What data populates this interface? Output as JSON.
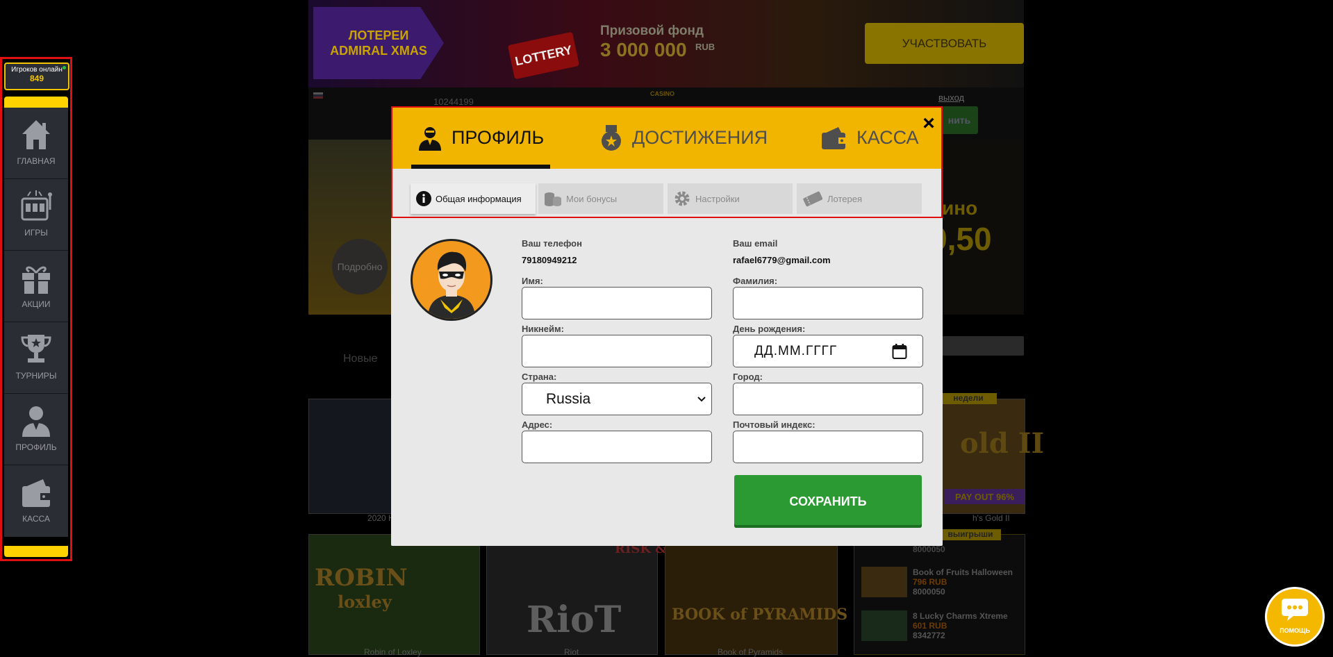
{
  "banner": {
    "lottery_line1": "ЛОТЕРЕИ",
    "lottery_line2": "ADMIRAL XMAS",
    "tag": "LOTTERY",
    "prize_title": "Призовой фонд",
    "prize_amount": "3 000 000",
    "prize_currency": "RUB",
    "participate": "УЧАСТВОВАТЬ"
  },
  "header": {
    "user_id": "10244199",
    "logout": "выход",
    "logo_small": "CASINO",
    "deposit_partial": "нить"
  },
  "hero": {
    "more": "Подробно",
    "text1": "ино",
    "text2": "9,50"
  },
  "categories": {
    "new": "Новые"
  },
  "games": {
    "caption1": "2020 H",
    "caption_right": "h's Gold II",
    "week_label": "недели",
    "payout": "PAY OUT 96%",
    "wins_label": "выигрыши",
    "tile1": "ROBIN",
    "tile1_sub": "loxley",
    "tile2": "RioT",
    "tile3": "BOOK of PYRAMIDS",
    "tile1_caption": "Robin of Loxley",
    "tile2_caption": "Riot",
    "tile3_caption": "Book of Pyramids",
    "risk_buy": "RISK &Buy",
    "gold_text": "old II",
    "win_partial_id": "8000050"
  },
  "recent_wins": [
    {
      "name": "Book of Fruits Halloween",
      "amount": "796 RUB",
      "id": "8000050"
    },
    {
      "name": "8 Lucky Charms Xtreme",
      "amount": "601 RUB",
      "id": "8342772"
    }
  ],
  "sidebar": {
    "online_label": "Игроков онлайн",
    "online_count": "849",
    "items": [
      {
        "label": "ГЛАВНАЯ",
        "icon": "home-icon"
      },
      {
        "label": "ИГРЫ",
        "icon": "slot-machine-icon"
      },
      {
        "label": "АКЦИИ",
        "icon": "gift-icon"
      },
      {
        "label": "ТУРНИРЫ",
        "icon": "trophy-icon"
      },
      {
        "label": "ПРОФИЛЬ",
        "icon": "user-icon"
      },
      {
        "label": "КАССА",
        "icon": "wallet-icon"
      }
    ]
  },
  "modal": {
    "tabs": [
      {
        "label": "ПРОФИЛЬ",
        "icon": "user-icon",
        "active": true
      },
      {
        "label": "ДОСТИЖЕНИЯ",
        "icon": "medal-icon",
        "active": false
      },
      {
        "label": "КАССА",
        "icon": "wallet-icon",
        "active": false
      }
    ],
    "close": "×",
    "subtabs": [
      {
        "label": "Общая информация",
        "icon": "info-icon",
        "active": true
      },
      {
        "label": "Мои бонусы",
        "icon": "coins-icon",
        "active": false
      },
      {
        "label": "Настройки",
        "icon": "gear-icon",
        "active": false
      },
      {
        "label": "Лотерея",
        "icon": "ticket-icon",
        "active": false
      }
    ],
    "phone_label": "Ваш телефон",
    "phone_value": "79180949212",
    "email_label": "Ваш email",
    "email_value": "rafael6779@gmail.com",
    "fields": {
      "first_name": {
        "label": "Имя:",
        "value": ""
      },
      "last_name": {
        "label": "Фамилия:",
        "value": ""
      },
      "nickname": {
        "label": "Никнейм:",
        "value": ""
      },
      "birthday": {
        "label": "День рождения:",
        "placeholder": "ДД.ММ.ГГГГ"
      },
      "country": {
        "label": "Страна:",
        "value": "Russia"
      },
      "city": {
        "label": "Город:",
        "value": ""
      },
      "address": {
        "label": "Адрес:",
        "value": ""
      },
      "postal": {
        "label": "Почтовый индекс:",
        "value": ""
      }
    },
    "save": "СОХРАНИТЬ"
  },
  "help": {
    "label": "ПОМОЩЬ"
  },
  "colors": {
    "accent": "#f1b500",
    "save_green": "#2b9a32",
    "highlight_red": "#e01010",
    "sidebar_bg": "#2b2d35",
    "sidebar_yellow": "#ffd200"
  }
}
